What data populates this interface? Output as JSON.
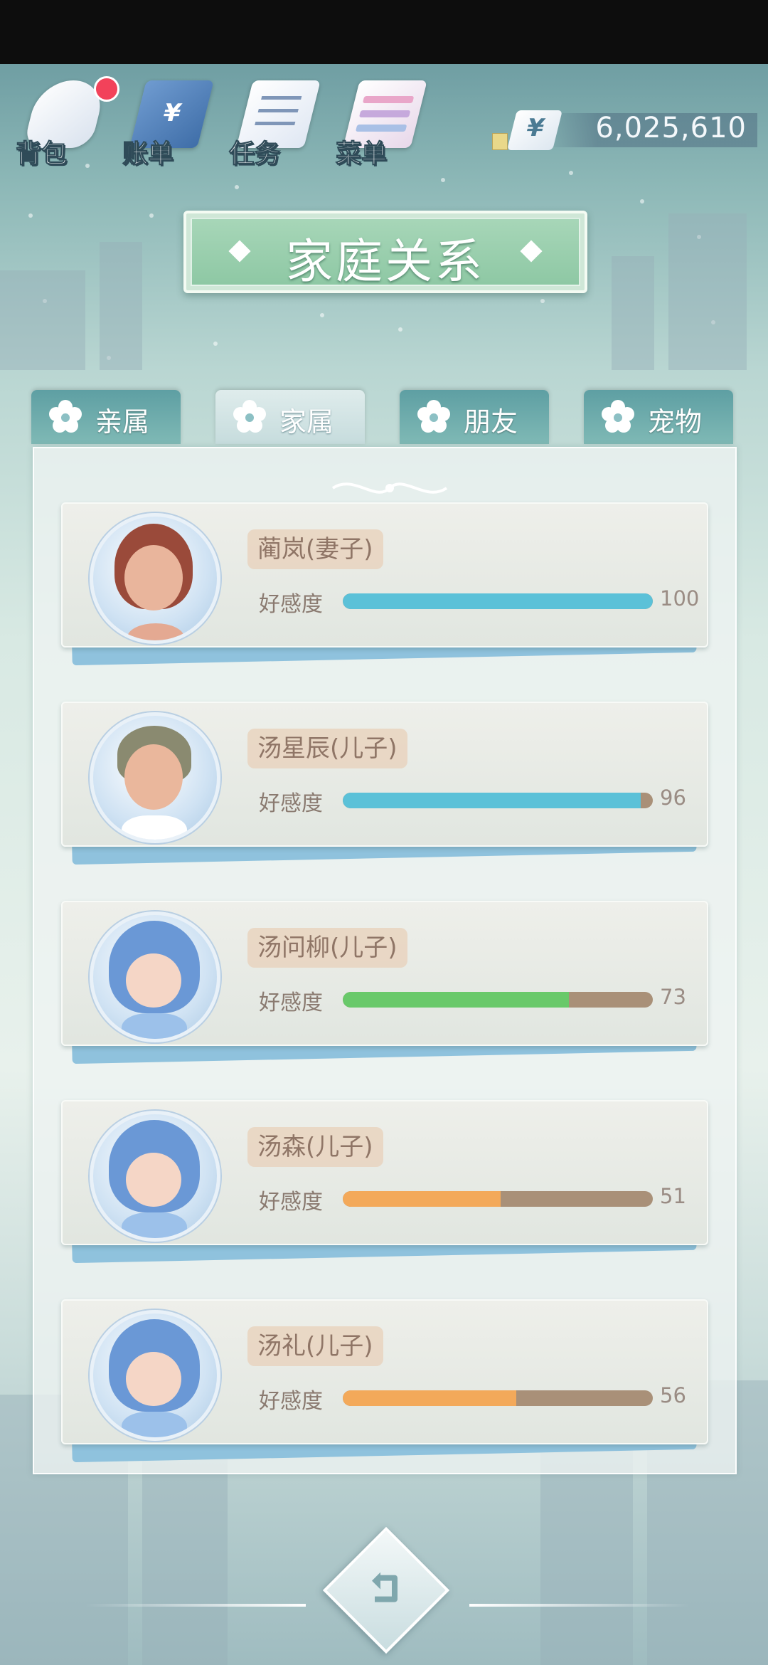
{
  "top_bar": {
    "buttons": [
      {
        "label": "背包",
        "icon": "backpack-icon",
        "has_notification": true
      },
      {
        "label": "账单",
        "icon": "bill-icon",
        "has_notification": false
      },
      {
        "label": "任务",
        "icon": "task-icon",
        "has_notification": false
      },
      {
        "label": "菜单",
        "icon": "menu-icon",
        "has_notification": false
      }
    ],
    "money": {
      "currency_symbol": "¥",
      "amount": "6,025,610"
    }
  },
  "title": "家庭关系",
  "tabs": [
    {
      "label": "亲属",
      "active": false
    },
    {
      "label": "家属",
      "active": true
    },
    {
      "label": "朋友",
      "active": false
    },
    {
      "label": "宠物",
      "active": false
    }
  ],
  "affection_label": "好感度",
  "members": [
    {
      "name": "蔺岚(妻子)",
      "affection": 100,
      "affection_text": "100",
      "bar_color": "#5bc1d8",
      "avatar": "girl-brown-hair"
    },
    {
      "name": "汤星辰(儿子)",
      "affection": 96,
      "affection_text": "96",
      "bar_color": "#5bc1d8",
      "avatar": "boy-olive-hair"
    },
    {
      "name": "汤问柳(儿子)",
      "affection": 73,
      "affection_text": "73",
      "bar_color": "#69c96a",
      "avatar": "baby-blue-hood"
    },
    {
      "name": "汤森(儿子)",
      "affection": 51,
      "affection_text": "51",
      "bar_color": "#f3a95a",
      "avatar": "baby-blue-hood"
    },
    {
      "name": "汤礼(儿子)",
      "affection": 56,
      "affection_text": "56",
      "bar_color": "#f3a95a",
      "avatar": "baby-blue-hood"
    }
  ],
  "colors": {
    "tab_teal": "#6aa9ab",
    "title_green": "#9fd0b2",
    "notification_red": "#f2425a",
    "bar_track": "#a99078"
  }
}
